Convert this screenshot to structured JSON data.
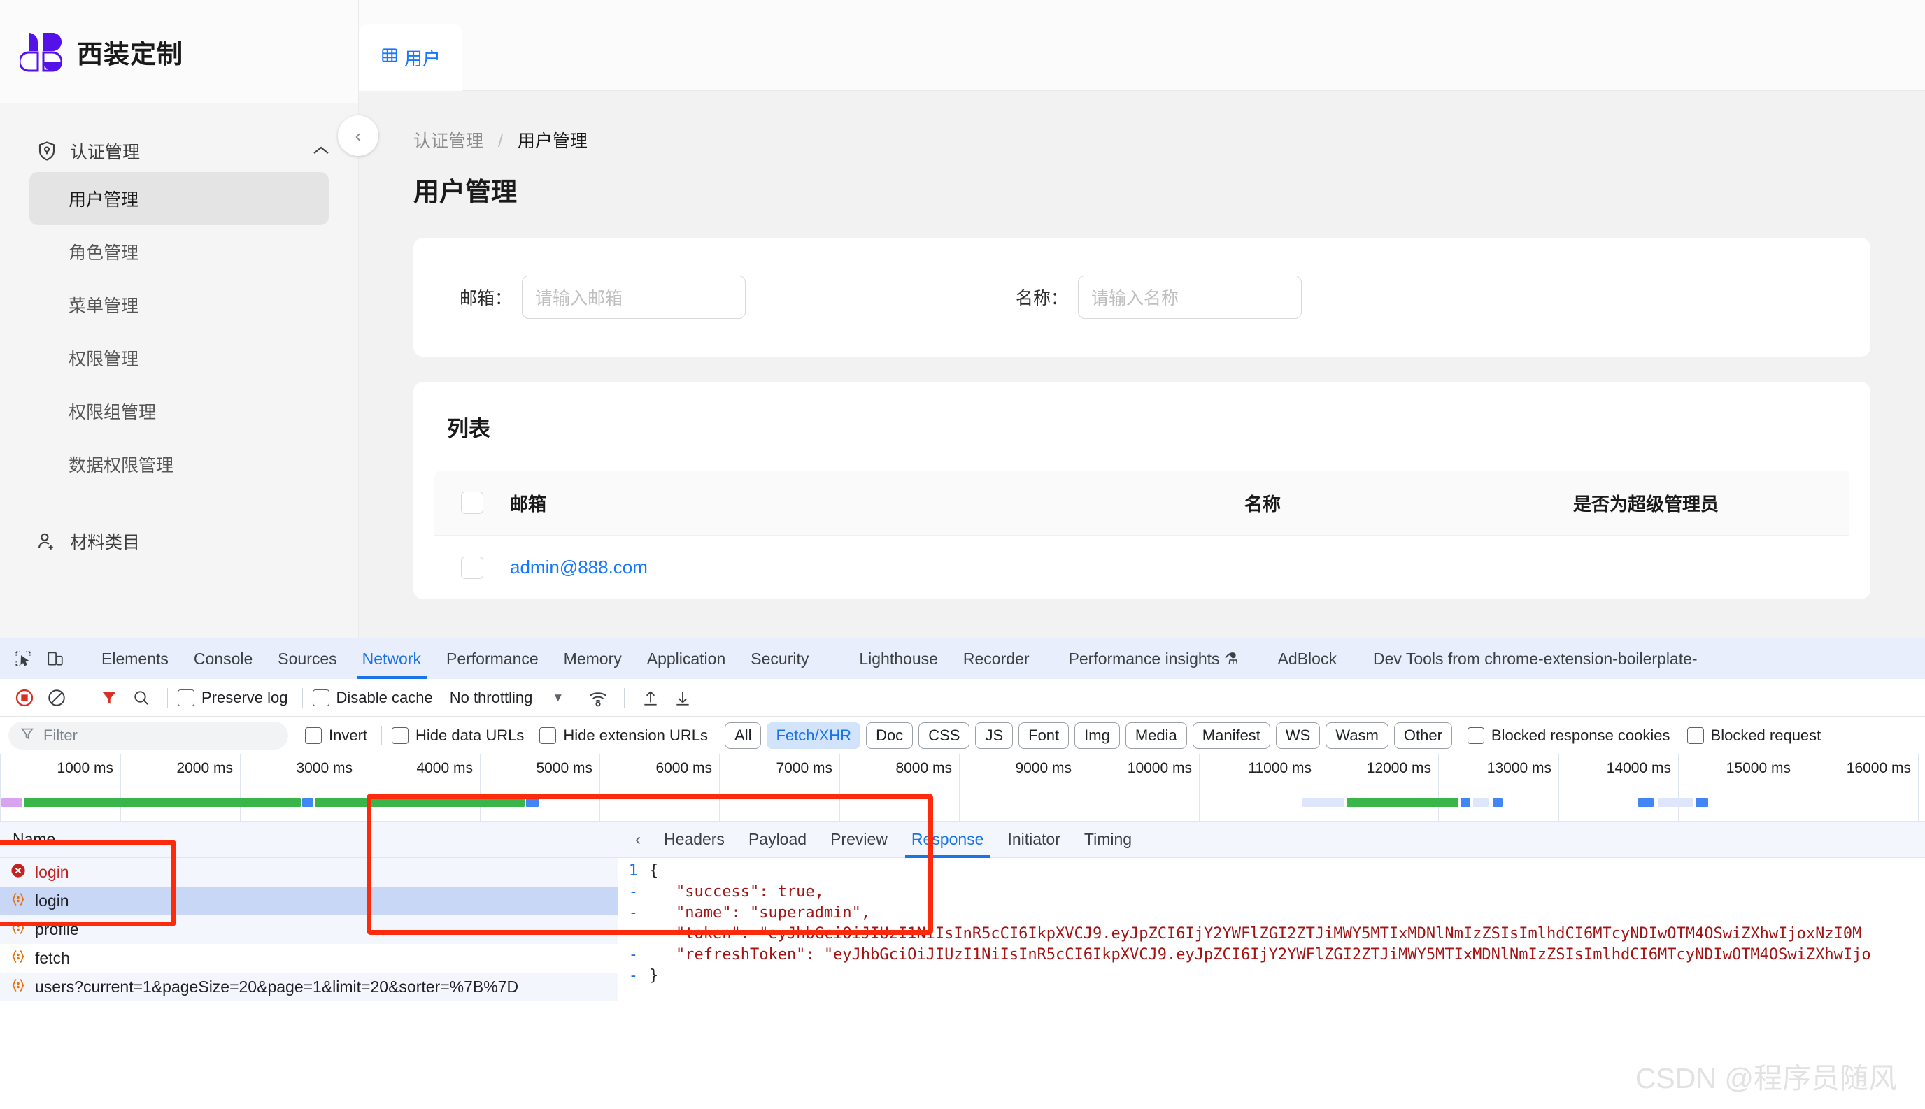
{
  "app": {
    "brand": {
      "title": "西装定制",
      "logo_icon": "four-petal-logo-icon"
    },
    "sidebar": {
      "group": {
        "label": "认证管理",
        "icon": "shield-check-icon",
        "chevron": "chevron-up-icon"
      },
      "items": [
        {
          "label": "用户管理",
          "active": true
        },
        {
          "label": "角色管理",
          "active": false
        },
        {
          "label": "菜单管理",
          "active": false
        },
        {
          "label": "权限管理",
          "active": false
        },
        {
          "label": "权限组管理",
          "active": false
        },
        {
          "label": "数据权限管理",
          "active": false
        }
      ],
      "leaf": {
        "label": "材料类目",
        "icon": "user-add-icon"
      },
      "collapse_icon": "chevron-left-icon"
    },
    "tab": {
      "label": "用户",
      "icon": "table-icon"
    },
    "breadcrumb": {
      "parent": "认证管理",
      "separator": "/",
      "current": "用户管理"
    },
    "page_title": "用户管理",
    "search": {
      "email": {
        "label": "邮箱：",
        "value": "",
        "placeholder": "请输入邮箱"
      },
      "name": {
        "label": "名称：",
        "value": "",
        "placeholder": "请输入名称"
      }
    },
    "list": {
      "title": "列表",
      "columns": [
        "邮箱",
        "名称",
        "是否为超级管理员"
      ],
      "rows": [
        {
          "email": "admin@888.com",
          "name": "",
          "super": ""
        }
      ]
    }
  },
  "devtools": {
    "panel_tabs": [
      "Elements",
      "Console",
      "Sources",
      "Network",
      "Performance",
      "Memory",
      "Application",
      "Security",
      "Lighthouse",
      "Recorder",
      "Performance insights ⚗",
      "AdBlock",
      "Dev Tools from chrome-extension-boilerplate-"
    ],
    "active_panel": "Network",
    "toolbar": {
      "record_icon": "record-stop-icon",
      "clear_icon": "clear-circle-icon",
      "filter_icon": "funnel-icon",
      "search_icon": "search-icon",
      "preserve_log": "Preserve log",
      "disable_cache": "Disable cache",
      "throttling": "No throttling",
      "throttle_caret": "▼",
      "wifi_icon": "network-conditions-icon",
      "import_icon": "import-har-icon",
      "export_icon": "export-har-icon"
    },
    "filterbar": {
      "filter_placeholder": "Filter",
      "filter_icon": "funnel-icon",
      "invert": "Invert",
      "hide_data_urls": "Hide data URLs",
      "hide_extension_urls": "Hide extension URLs",
      "types": [
        "All",
        "Fetch/XHR",
        "Doc",
        "CSS",
        "JS",
        "Font",
        "Img",
        "Media",
        "Manifest",
        "WS",
        "Wasm",
        "Other"
      ],
      "active_type": "Fetch/XHR",
      "blocked_response_cookies": "Blocked response cookies",
      "blocked_requests": "Blocked request"
    },
    "timeline": {
      "labels": [
        "1000 ms",
        "2000 ms",
        "3000 ms",
        "4000 ms",
        "5000 ms",
        "6000 ms",
        "7000 ms",
        "8000 ms",
        "9000 ms",
        "10000 ms",
        "11000 ms",
        "12000 ms",
        "13000 ms",
        "14000 ms",
        "15000 ms",
        "16000 ms"
      ]
    },
    "request_list": {
      "header": "Name",
      "rows": [
        {
          "name": "login",
          "icon": "error-circle-icon",
          "state": "error"
        },
        {
          "name": "login",
          "icon": "json-braces-icon",
          "state": "selected"
        },
        {
          "name": "profile",
          "icon": "json-braces-icon",
          "state": "normal"
        },
        {
          "name": "fetch",
          "icon": "json-braces-icon",
          "state": "normal"
        },
        {
          "name": "users?current=1&pageSize=20&page=1&limit=20&sorter=%7B%7D",
          "icon": "json-braces-icon",
          "state": "normal"
        }
      ]
    },
    "response_panel": {
      "back_icon": "chevron-left-icon",
      "tabs": [
        "Headers",
        "Payload",
        "Preview",
        "Response",
        "Initiator",
        "Timing"
      ],
      "active_tab": "Response",
      "code_lines": [
        {
          "gutter": "1",
          "content": "{",
          "indent": 0
        },
        {
          "gutter": "-",
          "content": "\"success\": true,",
          "indent": 1
        },
        {
          "gutter": "-",
          "content": "\"name\": \"superadmin\",",
          "indent": 1
        },
        {
          "gutter": "-",
          "content": "\"token\": \"eyJhbGciOiJIUzI1NiIsInR5cCI6IkpXVCJ9.eyJpZCI6IjY2YWFlZGI2ZTJiMWY5MTIxMDNlNmIzZSIsImlhdCI6MTcyNDIwOTM4OSwiZXhwIjoxNzI0M",
          "indent": 1
        },
        {
          "gutter": "-",
          "content": "\"refreshToken\": \"eyJhbGciOiJIUzI1NiIsInR5cCI6IkpXVCJ9.eyJpZCI6IjY2YWFlZGI2ZTJiMWY5MTIxMDNlNmIzZSIsImlhdCI6MTcyNDIwOTM4OSwiZXhwIjo",
          "indent": 1
        },
        {
          "gutter": "-",
          "content": "}",
          "indent": 0
        }
      ]
    }
  },
  "watermark": "CSDN @程序员随风",
  "colors": {
    "brand_purple": "#5412e8",
    "link_blue": "#1677ff",
    "devtools_blue": "#1a73e8",
    "error_red": "#c5221f",
    "annotation_red": "#fd2b0c",
    "json_string": "#a31515"
  }
}
